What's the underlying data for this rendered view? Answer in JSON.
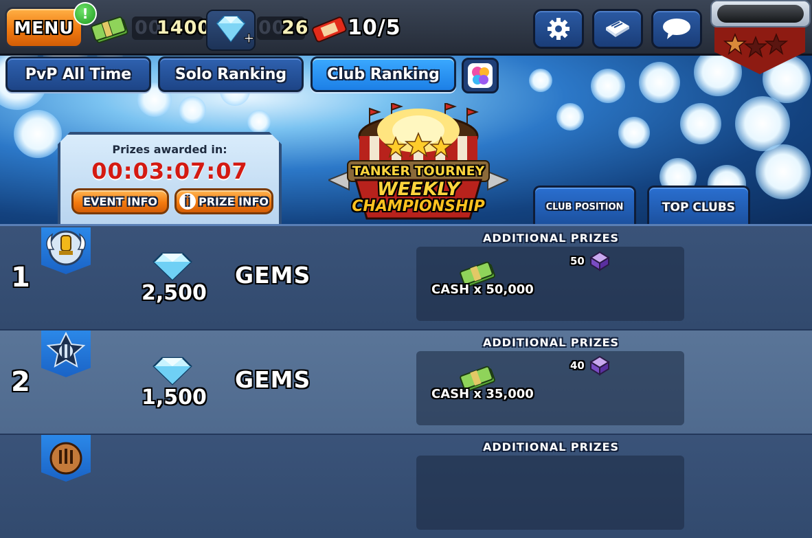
{
  "topbar": {
    "menu_label": "MENU",
    "menu_alert": "!",
    "cash_ghost": "00",
    "cash_value": "1400",
    "gems_ghost": "00",
    "gems_value": "26",
    "tickets_value": "10/5",
    "icons": {
      "cash": "cash-stack-icon",
      "gems": "diamond-plus-icon",
      "ticket": "event-ticket-icon",
      "settings": "gear-icon",
      "news": "newspaper-icon",
      "chat": "chat-bubble-icon"
    }
  },
  "tabs": [
    {
      "label": "PvP All Time",
      "active": false
    },
    {
      "label": "Solo Ranking",
      "active": false
    },
    {
      "label": "Club Ranking",
      "active": true
    }
  ],
  "timer": {
    "label": "Prizes awarded in:",
    "value": "00:03:07:07",
    "event_info_label": "EVENT INFO",
    "prize_info_label": "PRIZE INFO"
  },
  "logo": {
    "line1": "TANKER TOURNEY",
    "line2": "WEEKLY",
    "line3": "CHAMPIONSHIP"
  },
  "right_tabs": {
    "club_position": "CLUB POSITION",
    "top_clubs": "TOP CLUBS"
  },
  "prizes": [
    {
      "rank": "1",
      "gems": "2,500",
      "gems_word": "GEMS",
      "additional_title": "ADDITIONAL PRIZES",
      "cash": "CASH x 50,000",
      "crate_count": "50"
    },
    {
      "rank": "2",
      "gems": "1,500",
      "gems_word": "GEMS",
      "additional_title": "ADDITIONAL PRIZES",
      "cash": "CASH x 35,000",
      "crate_count": "40"
    },
    {
      "additional_title": "ADDITIONAL PRIZES"
    }
  ],
  "colors": {
    "accent_orange": "#f07a11",
    "timer_red": "#d41a12",
    "tab_blue": "#1d4486",
    "tab_active": "#1c7fe6"
  }
}
